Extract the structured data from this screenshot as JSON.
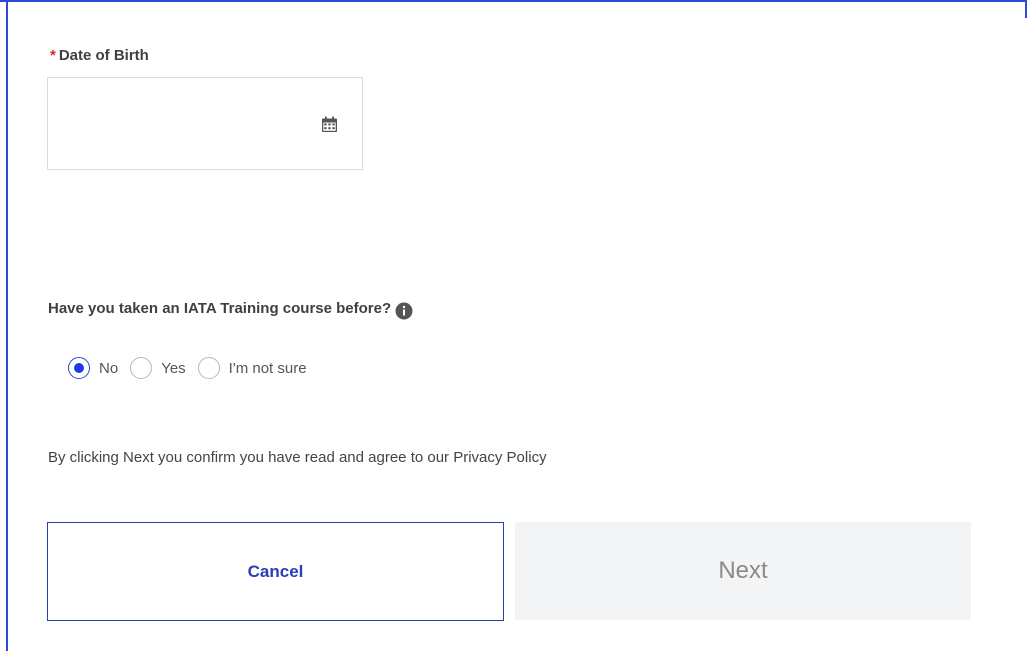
{
  "form": {
    "dob": {
      "required_marker": "*",
      "label": "Date of Birth",
      "value": "",
      "placeholder": "",
      "icon": "calendar-icon"
    },
    "training_question": {
      "label": "Have you taken an IATA Training course before?",
      "info_icon": "info-icon",
      "options": [
        {
          "label": "No",
          "selected": true
        },
        {
          "label": "Yes",
          "selected": false
        },
        {
          "label": "I'm not sure",
          "selected": false
        }
      ]
    },
    "consent_text": "By clicking Next you confirm you have read and agree to our Privacy Policy",
    "buttons": {
      "cancel_label": "Cancel",
      "next_label": "Next"
    }
  },
  "colors": {
    "accent": "#2a4bd7",
    "required": "#e02424",
    "radio_selected": "#1a3ce0",
    "next_disabled_bg": "#f3f4f5"
  }
}
